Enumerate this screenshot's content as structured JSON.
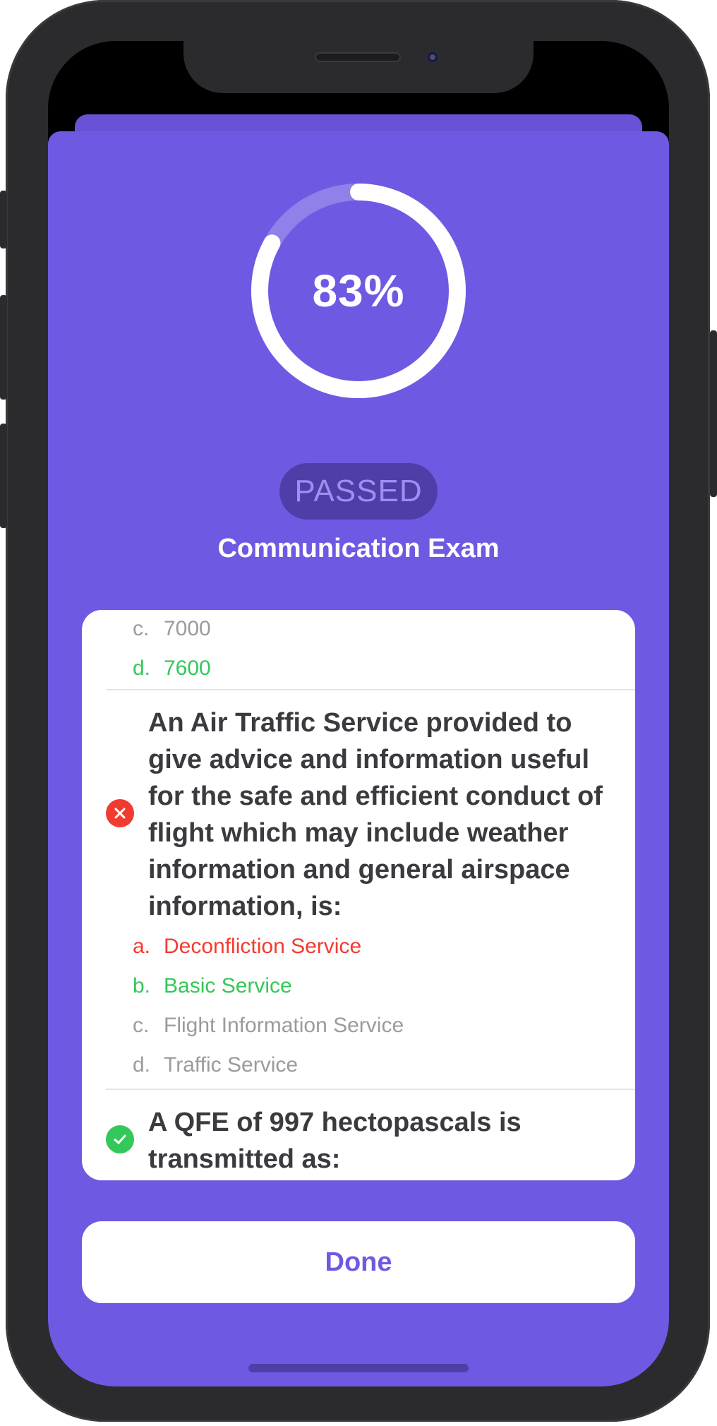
{
  "result": {
    "percent_label": "83%",
    "progress": 0.83,
    "status_label": "PASSED",
    "exam_title": "Communication Exam"
  },
  "review": {
    "prev_question_options": [
      {
        "letter": "c.",
        "text": "7000",
        "state": "neutral"
      },
      {
        "letter": "d.",
        "text": "7600",
        "state": "correct"
      }
    ],
    "question_2": {
      "result": "wrong",
      "text": "An Air Traffic Service provided to give advice and information useful for the safe and efficient conduct of flight which may include weather information and general airspace information, is:",
      "options": [
        {
          "letter": "a.",
          "text": "Deconfliction Service",
          "state": "selected-wrong"
        },
        {
          "letter": "b.",
          "text": "Basic Service",
          "state": "correct"
        },
        {
          "letter": "c.",
          "text": "Flight Information Service",
          "state": "neutral"
        },
        {
          "letter": "d.",
          "text": "Traffic Service",
          "state": "neutral"
        }
      ]
    },
    "question_3": {
      "result": "right",
      "text": "A QFE of 997 hectopascals is transmitted as:"
    }
  },
  "footer": {
    "done_label": "Done"
  },
  "colors": {
    "accent": "#6e5ae2",
    "correct": "#34c759",
    "wrong": "#f23b30",
    "neutral": "#9b9b9f"
  },
  "icons": {
    "wrong": "x-mark-icon",
    "right": "checkmark-icon"
  }
}
